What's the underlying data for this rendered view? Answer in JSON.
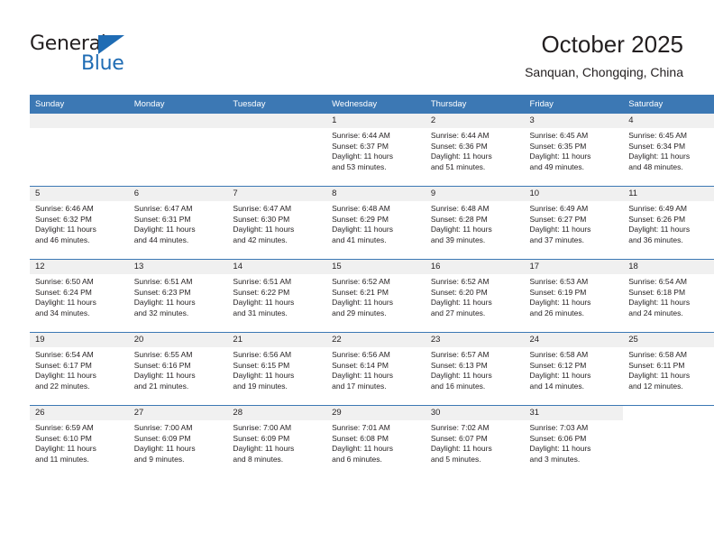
{
  "brand": {
    "name_top": "General",
    "name_bottom": "Blue",
    "accent_color": "#1f6cb4"
  },
  "header": {
    "title": "October 2025",
    "subtitle": "Sanquan, Chongqing, China"
  },
  "theme": {
    "header_row_bg": "#3c78b4",
    "day_band_bg": "#f0f0f0",
    "text_color": "#231f20"
  },
  "weekday_headers": [
    "Sunday",
    "Monday",
    "Tuesday",
    "Wednesday",
    "Thursday",
    "Friday",
    "Saturday"
  ],
  "weeks": [
    [
      {
        "day": "",
        "state": "empty",
        "sunrise": "",
        "sunset": "",
        "daylight_1": "",
        "daylight_2": ""
      },
      {
        "day": "",
        "state": "empty",
        "sunrise": "",
        "sunset": "",
        "daylight_1": "",
        "daylight_2": ""
      },
      {
        "day": "",
        "state": "empty",
        "sunrise": "",
        "sunset": "",
        "daylight_1": "",
        "daylight_2": ""
      },
      {
        "day": "1",
        "state": "filled",
        "sunrise": "Sunrise: 6:44 AM",
        "sunset": "Sunset: 6:37 PM",
        "daylight_1": "Daylight: 11 hours",
        "daylight_2": "and 53 minutes."
      },
      {
        "day": "2",
        "state": "filled",
        "sunrise": "Sunrise: 6:44 AM",
        "sunset": "Sunset: 6:36 PM",
        "daylight_1": "Daylight: 11 hours",
        "daylight_2": "and 51 minutes."
      },
      {
        "day": "3",
        "state": "filled",
        "sunrise": "Sunrise: 6:45 AM",
        "sunset": "Sunset: 6:35 PM",
        "daylight_1": "Daylight: 11 hours",
        "daylight_2": "and 49 minutes."
      },
      {
        "day": "4",
        "state": "filled",
        "sunrise": "Sunrise: 6:45 AM",
        "sunset": "Sunset: 6:34 PM",
        "daylight_1": "Daylight: 11 hours",
        "daylight_2": "and 48 minutes."
      }
    ],
    [
      {
        "day": "5",
        "state": "filled",
        "sunrise": "Sunrise: 6:46 AM",
        "sunset": "Sunset: 6:32 PM",
        "daylight_1": "Daylight: 11 hours",
        "daylight_2": "and 46 minutes."
      },
      {
        "day": "6",
        "state": "filled",
        "sunrise": "Sunrise: 6:47 AM",
        "sunset": "Sunset: 6:31 PM",
        "daylight_1": "Daylight: 11 hours",
        "daylight_2": "and 44 minutes."
      },
      {
        "day": "7",
        "state": "filled",
        "sunrise": "Sunrise: 6:47 AM",
        "sunset": "Sunset: 6:30 PM",
        "daylight_1": "Daylight: 11 hours",
        "daylight_2": "and 42 minutes."
      },
      {
        "day": "8",
        "state": "filled",
        "sunrise": "Sunrise: 6:48 AM",
        "sunset": "Sunset: 6:29 PM",
        "daylight_1": "Daylight: 11 hours",
        "daylight_2": "and 41 minutes."
      },
      {
        "day": "9",
        "state": "filled",
        "sunrise": "Sunrise: 6:48 AM",
        "sunset": "Sunset: 6:28 PM",
        "daylight_1": "Daylight: 11 hours",
        "daylight_2": "and 39 minutes."
      },
      {
        "day": "10",
        "state": "filled",
        "sunrise": "Sunrise: 6:49 AM",
        "sunset": "Sunset: 6:27 PM",
        "daylight_1": "Daylight: 11 hours",
        "daylight_2": "and 37 minutes."
      },
      {
        "day": "11",
        "state": "filled",
        "sunrise": "Sunrise: 6:49 AM",
        "sunset": "Sunset: 6:26 PM",
        "daylight_1": "Daylight: 11 hours",
        "daylight_2": "and 36 minutes."
      }
    ],
    [
      {
        "day": "12",
        "state": "filled",
        "sunrise": "Sunrise: 6:50 AM",
        "sunset": "Sunset: 6:24 PM",
        "daylight_1": "Daylight: 11 hours",
        "daylight_2": "and 34 minutes."
      },
      {
        "day": "13",
        "state": "filled",
        "sunrise": "Sunrise: 6:51 AM",
        "sunset": "Sunset: 6:23 PM",
        "daylight_1": "Daylight: 11 hours",
        "daylight_2": "and 32 minutes."
      },
      {
        "day": "14",
        "state": "filled",
        "sunrise": "Sunrise: 6:51 AM",
        "sunset": "Sunset: 6:22 PM",
        "daylight_1": "Daylight: 11 hours",
        "daylight_2": "and 31 minutes."
      },
      {
        "day": "15",
        "state": "filled",
        "sunrise": "Sunrise: 6:52 AM",
        "sunset": "Sunset: 6:21 PM",
        "daylight_1": "Daylight: 11 hours",
        "daylight_2": "and 29 minutes."
      },
      {
        "day": "16",
        "state": "filled",
        "sunrise": "Sunrise: 6:52 AM",
        "sunset": "Sunset: 6:20 PM",
        "daylight_1": "Daylight: 11 hours",
        "daylight_2": "and 27 minutes."
      },
      {
        "day": "17",
        "state": "filled",
        "sunrise": "Sunrise: 6:53 AM",
        "sunset": "Sunset: 6:19 PM",
        "daylight_1": "Daylight: 11 hours",
        "daylight_2": "and 26 minutes."
      },
      {
        "day": "18",
        "state": "filled",
        "sunrise": "Sunrise: 6:54 AM",
        "sunset": "Sunset: 6:18 PM",
        "daylight_1": "Daylight: 11 hours",
        "daylight_2": "and 24 minutes."
      }
    ],
    [
      {
        "day": "19",
        "state": "filled",
        "sunrise": "Sunrise: 6:54 AM",
        "sunset": "Sunset: 6:17 PM",
        "daylight_1": "Daylight: 11 hours",
        "daylight_2": "and 22 minutes."
      },
      {
        "day": "20",
        "state": "filled",
        "sunrise": "Sunrise: 6:55 AM",
        "sunset": "Sunset: 6:16 PM",
        "daylight_1": "Daylight: 11 hours",
        "daylight_2": "and 21 minutes."
      },
      {
        "day": "21",
        "state": "filled",
        "sunrise": "Sunrise: 6:56 AM",
        "sunset": "Sunset: 6:15 PM",
        "daylight_1": "Daylight: 11 hours",
        "daylight_2": "and 19 minutes."
      },
      {
        "day": "22",
        "state": "filled",
        "sunrise": "Sunrise: 6:56 AM",
        "sunset": "Sunset: 6:14 PM",
        "daylight_1": "Daylight: 11 hours",
        "daylight_2": "and 17 minutes."
      },
      {
        "day": "23",
        "state": "filled",
        "sunrise": "Sunrise: 6:57 AM",
        "sunset": "Sunset: 6:13 PM",
        "daylight_1": "Daylight: 11 hours",
        "daylight_2": "and 16 minutes."
      },
      {
        "day": "24",
        "state": "filled",
        "sunrise": "Sunrise: 6:58 AM",
        "sunset": "Sunset: 6:12 PM",
        "daylight_1": "Daylight: 11 hours",
        "daylight_2": "and 14 minutes."
      },
      {
        "day": "25",
        "state": "filled",
        "sunrise": "Sunrise: 6:58 AM",
        "sunset": "Sunset: 6:11 PM",
        "daylight_1": "Daylight: 11 hours",
        "daylight_2": "and 12 minutes."
      }
    ],
    [
      {
        "day": "26",
        "state": "filled",
        "sunrise": "Sunrise: 6:59 AM",
        "sunset": "Sunset: 6:10 PM",
        "daylight_1": "Daylight: 11 hours",
        "daylight_2": "and 11 minutes."
      },
      {
        "day": "27",
        "state": "filled",
        "sunrise": "Sunrise: 7:00 AM",
        "sunset": "Sunset: 6:09 PM",
        "daylight_1": "Daylight: 11 hours",
        "daylight_2": "and 9 minutes."
      },
      {
        "day": "28",
        "state": "filled",
        "sunrise": "Sunrise: 7:00 AM",
        "sunset": "Sunset: 6:09 PM",
        "daylight_1": "Daylight: 11 hours",
        "daylight_2": "and 8 minutes."
      },
      {
        "day": "29",
        "state": "filled",
        "sunrise": "Sunrise: 7:01 AM",
        "sunset": "Sunset: 6:08 PM",
        "daylight_1": "Daylight: 11 hours",
        "daylight_2": "and 6 minutes."
      },
      {
        "day": "30",
        "state": "filled",
        "sunrise": "Sunrise: 7:02 AM",
        "sunset": "Sunset: 6:07 PM",
        "daylight_1": "Daylight: 11 hours",
        "daylight_2": "and 5 minutes."
      },
      {
        "day": "31",
        "state": "filled",
        "sunrise": "Sunrise: 7:03 AM",
        "sunset": "Sunset: 6:06 PM",
        "daylight_1": "Daylight: 11 hours",
        "daylight_2": "and 3 minutes."
      },
      {
        "day": "",
        "state": "blank",
        "sunrise": "",
        "sunset": "",
        "daylight_1": "",
        "daylight_2": ""
      }
    ]
  ]
}
